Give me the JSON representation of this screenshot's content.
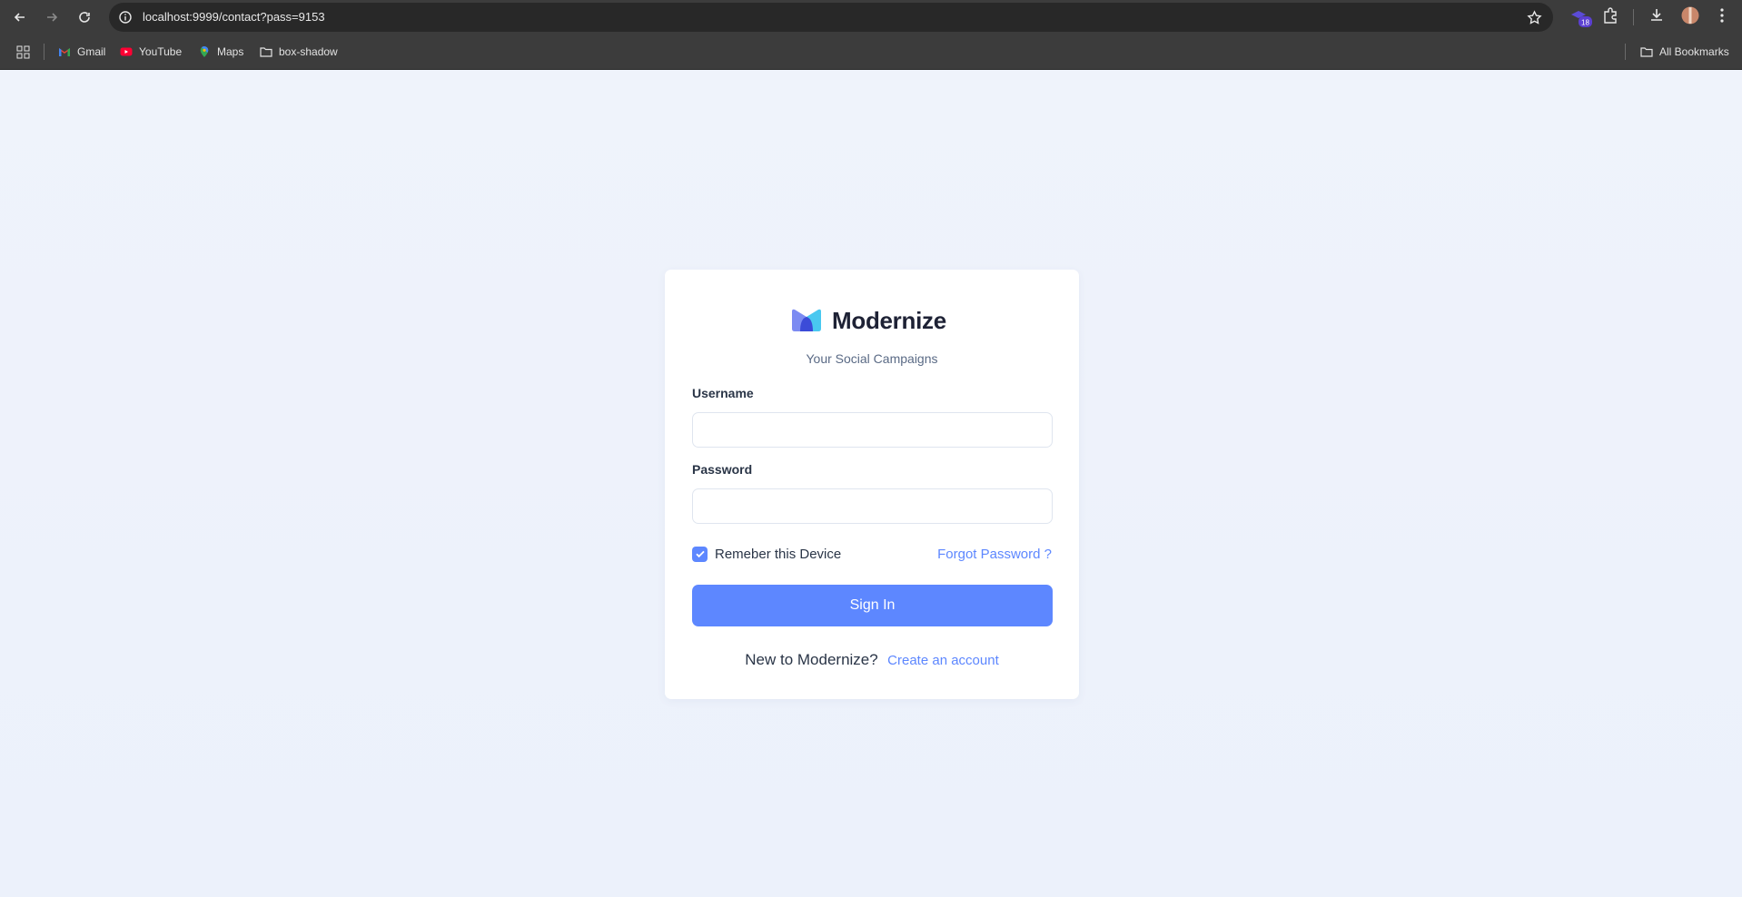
{
  "browser": {
    "url": "localhost:9999/contact?pass=9153",
    "extension_badge": "18",
    "bookmarks": [
      {
        "label": "Gmail",
        "icon": "gmail-icon"
      },
      {
        "label": "YouTube",
        "icon": "youtube-icon"
      },
      {
        "label": "Maps",
        "icon": "maps-icon"
      },
      {
        "label": "box-shadow",
        "icon": "folder-icon"
      }
    ],
    "all_bookmarks": "All Bookmarks"
  },
  "login": {
    "brand": "Modernize",
    "tagline": "Your Social Campaigns",
    "username_label": "Username",
    "username_value": "",
    "password_label": "Password",
    "password_value": "",
    "remember_label": "Remeber this Device",
    "remember_checked": true,
    "forgot_label": "Forgot Password ?",
    "signin_label": "Sign In",
    "new_user_text": "New to Modernize?",
    "create_account_label": "Create an account"
  },
  "colors": {
    "primary": "#5d87ff",
    "heading": "#2a3547",
    "muted": "#5a6a85",
    "page_bg": "#eef2fb"
  }
}
